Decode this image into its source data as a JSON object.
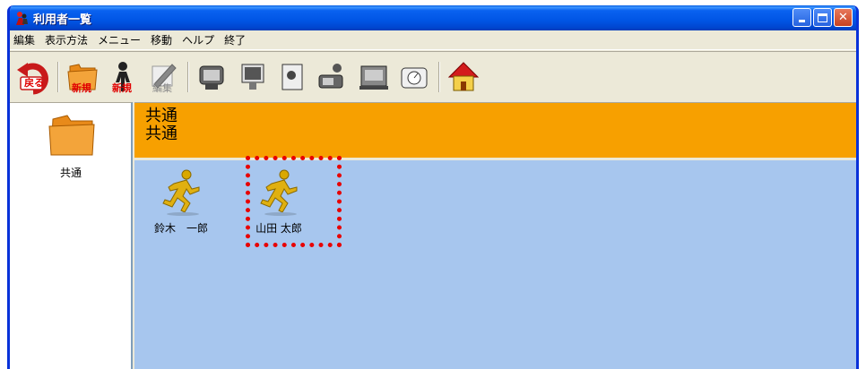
{
  "window": {
    "title": "利用者一覧",
    "controls": [
      "minimize-icon",
      "maximize-icon",
      "close-icon"
    ]
  },
  "menu": {
    "items": [
      "編集",
      "表示方法",
      "メニュー",
      "移動",
      "ヘルプ",
      "終了"
    ]
  },
  "toolbar": {
    "back_label": "戻る",
    "new_folder_label": "新規",
    "new_user_label": "新規",
    "edit_label": "編集"
  },
  "left_pane": {
    "folder_label": "共通"
  },
  "header": {
    "line1": "共通",
    "line2": "共通",
    "color": "#f7a000"
  },
  "users": [
    {
      "name": "鈴木　一郎",
      "icon": "running-person-icon"
    },
    {
      "name": "山田 太郎",
      "icon": "running-person-icon"
    }
  ],
  "colors": {
    "titlebar": "#0055e5",
    "user_area": "#a7c6ee",
    "highlight": "#e80000"
  }
}
